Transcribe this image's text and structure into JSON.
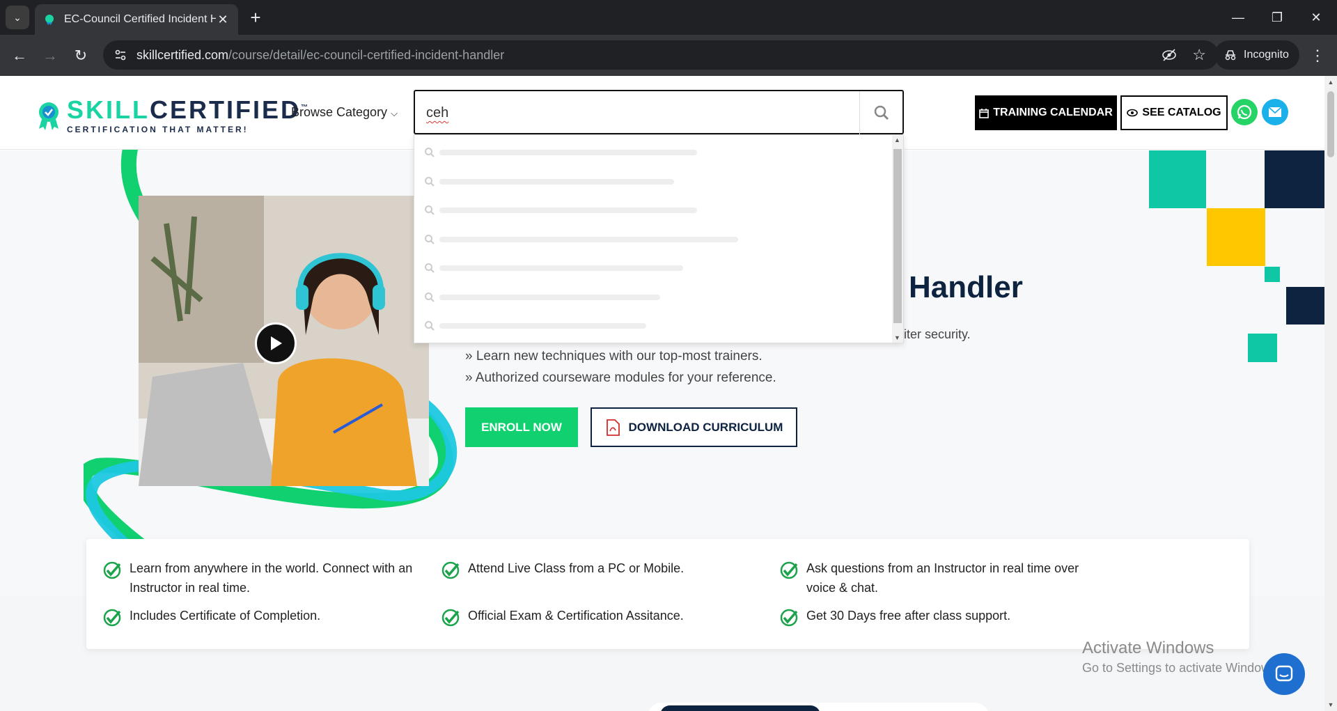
{
  "browser": {
    "tab_title": "EC-Council Certified Incident H",
    "url_host": "skillcertified.com",
    "url_path": "/course/detail/ec-council-certified-incident-handler",
    "incognito_label": "Incognito"
  },
  "header": {
    "logo_text_a": "SKILL",
    "logo_text_b": "CERTIFIED",
    "logo_tm": "™",
    "logo_tagline": "CERTIFICATION THAT MATTER!",
    "browse_label": "Browse Category",
    "search_value": "ceh",
    "training_calendar_label": "TRAINING CALENDAR",
    "see_catalog_label": "SEE CATALOG"
  },
  "hero": {
    "title_visible": "Handler",
    "line_security": "iter security.",
    "bullets": [
      "» Learn new techniques with our top-most trainers.",
      "» Authorized courseware modules for your reference."
    ],
    "enroll_label": "ENROLL NOW",
    "download_label": "DOWNLOAD CURRICULUM"
  },
  "features": [
    "Learn from anywhere in the world. Connect with an Instructor in real time.",
    "Attend Live Class from a PC or Mobile.",
    "Ask questions from an Instructor in real time over voice & chat.",
    "Includes Certificate of Completion.",
    "Official Exam & Certification Assitance.",
    "Get 30 Days free after class support."
  ],
  "dropdown_skeleton_fill": [
    0.56,
    0.51,
    0.56,
    0.65,
    0.53,
    0.48,
    0.45
  ],
  "watermark": {
    "line1": "Activate Windows",
    "line2": "Go to Settings to activate Windows."
  },
  "colors": {
    "brand_navy": "#0d2340",
    "brand_green": "#10d070",
    "brand_teal": "#19d3a2",
    "deco_yellow": "#ffc700",
    "deco_cyan": "#1ec8e0"
  },
  "icons": [
    "search-icon",
    "calendar-icon",
    "eye-icon",
    "whatsapp-icon",
    "mail-icon",
    "play-icon",
    "pdf-icon",
    "check-icon",
    "chat-icon"
  ]
}
